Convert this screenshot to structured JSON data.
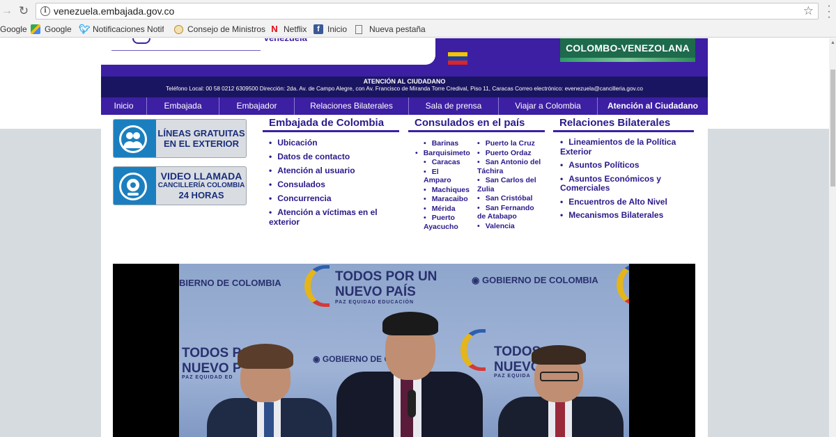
{
  "browser": {
    "url": "venezuela.embajada.gov.co",
    "bookmarks": [
      {
        "label": "Google",
        "icon": "google-icon"
      },
      {
        "label": "Google",
        "icon": "maps-icon"
      },
      {
        "label": "Notificaciones Notific",
        "icon": "twitter-icon"
      },
      {
        "label": "Consejo de Ministros",
        "icon": "seal-icon"
      },
      {
        "label": "Netflix",
        "icon": "netflix-icon"
      },
      {
        "label": "Inicio",
        "icon": "facebook-icon"
      },
      {
        "label": "Nueva pestaña",
        "icon": "page-icon"
      }
    ]
  },
  "header": {
    "venezuela_fragment": "Venezuela",
    "banner_text": "COLOMBO-VENEZOLANA"
  },
  "atencion": {
    "title": "ATENCIÓN AL CIUDADANO",
    "info": "Teléfono Local: 00 58 0212 6309500 Dirección: 2da. Av. de Campo Alegre, con Av. Francisco de Miranda Torre Credival, Piso 11, Caracas Correo electrónico: evenezuela@cancilleria.gov.co"
  },
  "menu": [
    "Inicio",
    "Embajada",
    "Embajador",
    "Relaciones Bilaterales",
    "Sala de prensa",
    "Viajar a Colombia",
    "Atención al Ciudadano"
  ],
  "ads": {
    "lineas": {
      "line1": "LÍNEAS GRATUITAS",
      "line2": "EN EL EXTERIOR"
    },
    "video": {
      "line1": "VIDEO LLAMADA",
      "line2": "CANCILLERÍA COLOMBIA",
      "line3": "24 HORAS"
    }
  },
  "columns": {
    "embajada": {
      "title": "Embajada de Colombia",
      "items": [
        "Ubicación",
        "Datos de contacto",
        "Atención al usuario",
        "Consulados",
        "Concurrencia",
        "Atención a víctimas en el exterior"
      ]
    },
    "consulados": {
      "title": "Consulados en el país",
      "left": [
        "Barinas",
        "Barquisimeto",
        "Caracas",
        "El Amparo",
        "Machiques",
        "Maracaibo",
        "Mérida",
        "Puerto Ayacucho"
      ],
      "right": [
        "Puerto la Cruz",
        "Puerto Ordaz",
        "San Antonio del Táchira",
        "San Carlos del Zulia",
        "San Cristóbal",
        "San Fernando de Atabapo",
        "Valencia"
      ]
    },
    "relaciones": {
      "title": "Relaciones Bilaterales",
      "items": [
        "Lineamientos de la Política Exterior",
        "Asuntos Políticos",
        "Asuntos Económicos y Comerciales",
        "Encuentros de Alto Nivel",
        "Mecanismos Bilaterales"
      ]
    }
  },
  "video": {
    "gob_a": "BIERNO DE COLOMBIA",
    "todos_a": "TODOS POR UN",
    "nuevo_a": "NUEVO PAÍS",
    "paz_a": "PAZ  EQUIDAD  EDUCACIÓN",
    "gob_b": "GOBIERNO DE COLOMBIA",
    "todos_b": "TODOS POR",
    "nuevo_b": "NUEVO PA",
    "paz_b": "PAZ  EQUIDAD  ED",
    "gob_c": "GOBIERNO DE CO",
    "todos_c": "TODOS",
    "nuevo_c": "NUEVO",
    "paz_c": "PAZ  EQUIDA"
  },
  "colors": {
    "brand_purple": "#3c1fa3",
    "dark_navy": "#1a1560",
    "link": "#2a1a8a"
  }
}
